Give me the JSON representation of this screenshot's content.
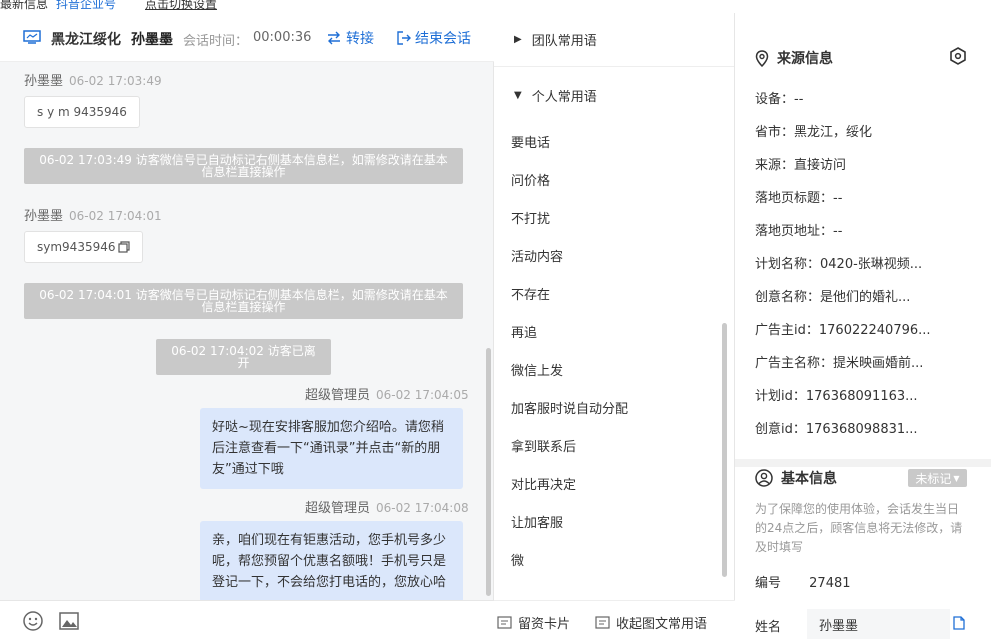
{
  "topbar": {
    "left": "最新信息",
    "platform": "抖音企业号",
    "link": "点击切换设置"
  },
  "header": {
    "region": "黑龙江绥化",
    "visitor": "孙墨墨",
    "duration_label": "会话时间：",
    "duration": "00:00:36",
    "transfer_label": "转接",
    "end_label": "结束会话"
  },
  "messages": [
    {
      "sender": "孙墨墨",
      "time": "06-02 17:03:49",
      "text": "s y m 9435946"
    },
    {
      "system": "06-02 17:03:49 访客微信号已自动标记右侧基本信息栏，如需修改请在基本信息栏直接操作"
    },
    {
      "sender": "孙墨墨",
      "time": "06-02 17:04:01",
      "text": "sym9435946"
    },
    {
      "system": "06-02 17:04:01 访客微信号已自动标记右侧基本信息栏，如需修改请在基本信息栏直接操作"
    },
    {
      "system": "06-02 17:04:02 访客已离开"
    },
    {
      "sender": "超级管理员",
      "time": "06-02 17:04:05",
      "text": "好哒~现在安排客服加您介绍哈。请您稍后注意查看一下“通讯录”并点击“新的朋友”通过下哦"
    },
    {
      "sender": "超级管理员",
      "time": "06-02 17:04:08",
      "text": "亲，咱们现在有钜惠活动，您手机号多少呢，帮您预留个优惠名额哦！手机号只是登记一下，不会给您打电话的，您放心哈"
    }
  ],
  "phrases": {
    "team_group": "团队常用语",
    "personal_group": "个人常用语",
    "items": [
      "要电话",
      "问价格",
      "不打扰",
      "活动内容",
      "不存在",
      "再追",
      "微信上发",
      "加客服时说自动分配",
      "拿到联系后",
      "对比再决定",
      "让加客服",
      "微"
    ],
    "footer_card": "留资卡片",
    "footer_collect": "收起图文常用语"
  },
  "info": {
    "source_title": "来源信息",
    "rows": [
      {
        "label": "设备：",
        "value": "--"
      },
      {
        "label": "省市：",
        "value": "黑龙江，绥化"
      },
      {
        "label": "来源：",
        "value": "直接访问"
      },
      {
        "label": "落地页标题：",
        "value": "--"
      },
      {
        "label": "落地页地址：",
        "value": "--"
      },
      {
        "label": "计划名称：",
        "value": "0420-张琳视频..."
      },
      {
        "label": "创意名称：",
        "value": "是他们的婚礼..."
      },
      {
        "label": "广告主id：",
        "value": "176022240796..."
      },
      {
        "label": "广告主名称：",
        "value": "提米映画婚前..."
      },
      {
        "label": "计划id：",
        "value": "176368091163..."
      },
      {
        "label": "创意id：",
        "value": "176368098831..."
      }
    ],
    "basic_title": "基本信息",
    "tag_label": "未标记",
    "notice": "为了保障您的使用体验，会话发生当日的24点之后，顾客信息将无法修改，请及时填写",
    "id_label": "编号",
    "id_value": "27481",
    "name_label": "姓名",
    "name_value": "孙墨墨"
  },
  "colors": {
    "accent": "#1f6fd6",
    "agent_bubble": "#dbe7fb",
    "system_bg": "#c9c9c9"
  }
}
